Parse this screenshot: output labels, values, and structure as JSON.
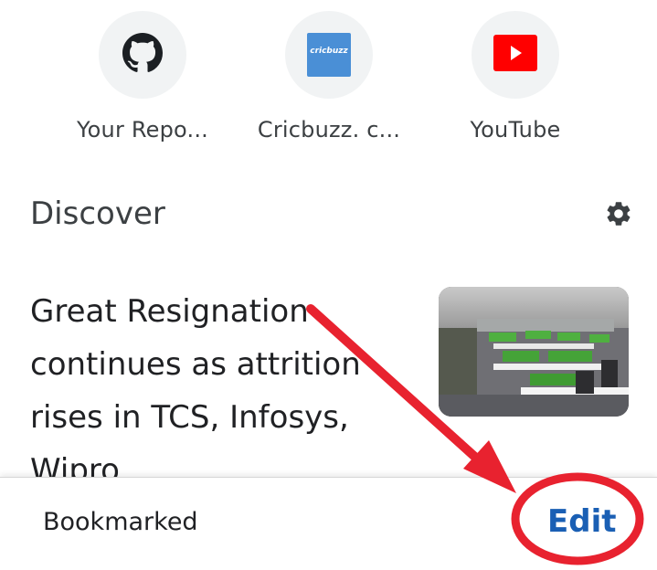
{
  "shortcuts": [
    {
      "label": "Your Repo...",
      "icon": "github-icon"
    },
    {
      "label": "Cricbuzz. c...",
      "icon": "cricbuzz-icon",
      "icon_text": "cricbuzz"
    },
    {
      "label": "YouTube",
      "icon": "youtube-icon"
    }
  ],
  "discover": {
    "title": "Discover",
    "settings_icon": "gear-icon"
  },
  "article": {
    "title": "Great Resignation continues as attrition rises in TCS, Infosys, Wipro"
  },
  "bottom_bar": {
    "bookmarked_label": "Bookmarked",
    "edit_label": "Edit"
  },
  "colors": {
    "annotation_red": "#e8222f",
    "link_blue": "#1a5fb4",
    "youtube_red": "#ff0000",
    "cricbuzz_blue": "#4a8fd6"
  }
}
